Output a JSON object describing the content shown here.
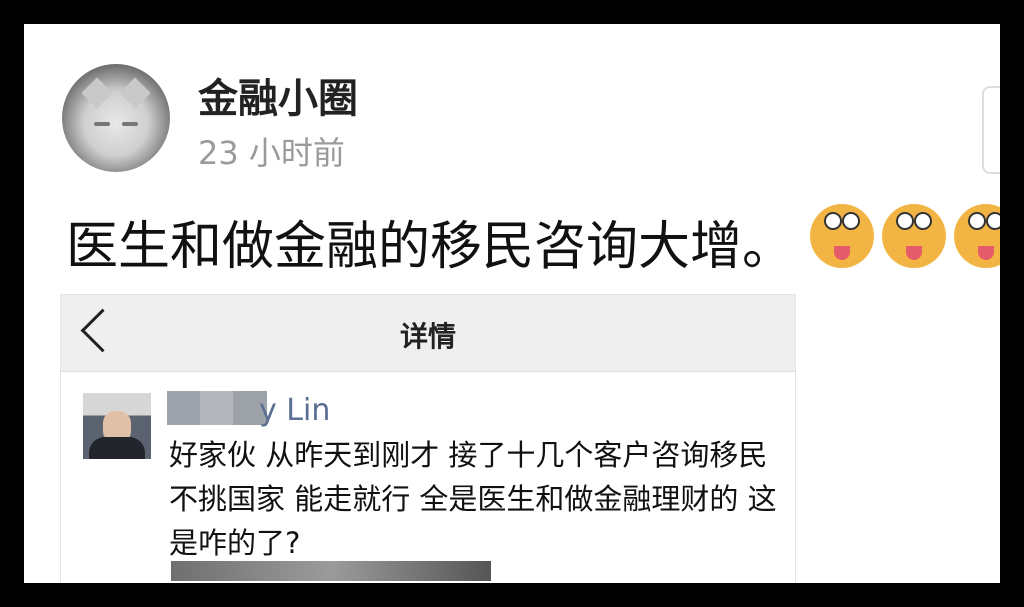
{
  "post": {
    "user_name": "金融小圈",
    "time": "23 小时前",
    "text": "医生和做金融的移民咨询大增。"
  },
  "screenshot": {
    "title": "详情",
    "comment": {
      "author_suffix": "y Lin",
      "text": "好家伙 从昨天到刚才 接了十几个客户咨询移民 不挑国家 能走就行 全是医生和做金融理财的 这是咋的了?"
    }
  },
  "icons": [
    "avatar",
    "dog-emoji",
    "back-icon"
  ]
}
